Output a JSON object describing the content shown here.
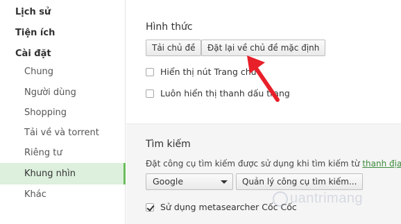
{
  "sidebar": {
    "sections": {
      "history": "Lịch sử",
      "extensions": "Tiện ích",
      "settings": "Cài đặt"
    },
    "items": [
      {
        "label": "Chung"
      },
      {
        "label": "Người dùng"
      },
      {
        "label": "Shopping"
      },
      {
        "label": "Tải về và torrent"
      },
      {
        "label": "Riêng tư"
      },
      {
        "label": "Khung nhìn"
      },
      {
        "label": "Khác"
      }
    ],
    "active_item": "Khung nhìn",
    "active_color": "#6bbd5b"
  },
  "appearance": {
    "heading": "Hình thức",
    "get_themes_button": "Tải chủ đề",
    "reset_theme_button": "Đặt lại về chủ đề mặc định",
    "show_home_button": {
      "label": "Hiển thị nút Trang chủ",
      "checked": false
    },
    "always_show_bookmarks": {
      "label": "Luôn hiển thị thanh dấu trang",
      "checked": false
    }
  },
  "search": {
    "heading": "Tìm kiếm",
    "description": "Đặt công cụ tìm kiếm được sử dụng khi tìm kiếm từ",
    "description_link": "thanh địa chỉ",
    "description_end": ".",
    "engine_selected": "Google",
    "manage_button": "Quản lý công cụ tìm kiếm...",
    "metasearcher": {
      "label": "Sử dụng metasearcher Cốc Cốc",
      "checked": true
    }
  },
  "annotation": {
    "arrow_color": "#e8202a"
  },
  "watermark": {
    "text": "uantrimang"
  }
}
